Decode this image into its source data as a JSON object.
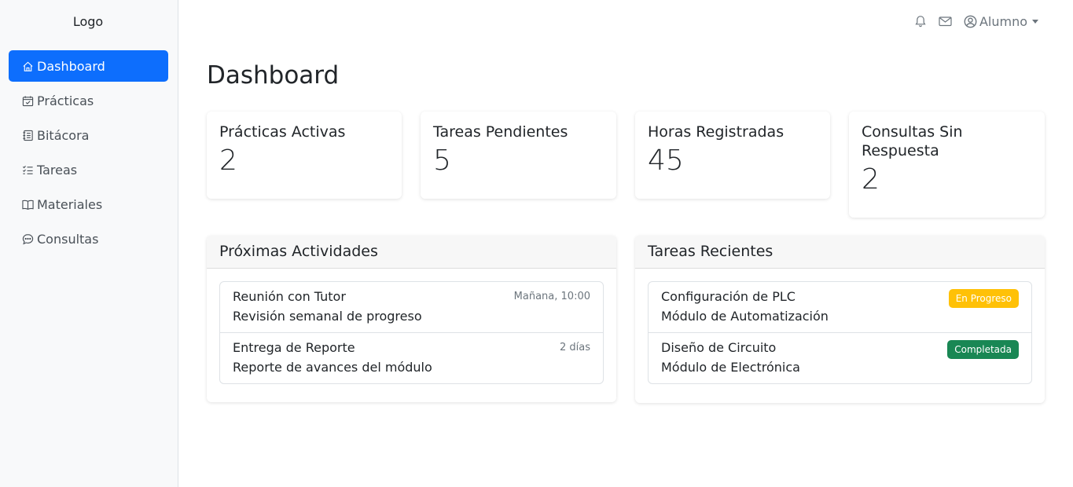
{
  "sidebar": {
    "logo": "Logo",
    "items": [
      {
        "label": "Dashboard",
        "icon": "house-icon",
        "active": true
      },
      {
        "label": "Prácticas",
        "icon": "calendar-check-icon"
      },
      {
        "label": "Bitácora",
        "icon": "journal-icon"
      },
      {
        "label": "Tareas",
        "icon": "list-check-icon"
      },
      {
        "label": "Materiales",
        "icon": "book-icon"
      },
      {
        "label": "Consultas",
        "icon": "chat-dots-icon"
      }
    ]
  },
  "topbar": {
    "notifications_icon": "bell-icon",
    "messages_icon": "envelope-icon",
    "user_icon": "person-circle-icon",
    "user_label": "Alumno"
  },
  "page": {
    "title": "Dashboard"
  },
  "stats": [
    {
      "label": "Prácticas Activas",
      "value": "2"
    },
    {
      "label": "Tareas Pendientes",
      "value": "5"
    },
    {
      "label": "Horas Registradas",
      "value": "45"
    },
    {
      "label": "Consultas Sin Respuesta",
      "value": "2"
    }
  ],
  "upcoming": {
    "title": "Próximas Actividades",
    "items": [
      {
        "title": "Reunión con Tutor",
        "subtitle": "Revisión semanal de progreso",
        "when": "Mañana, 10:00"
      },
      {
        "title": "Entrega de Reporte",
        "subtitle": "Reporte de avances del módulo",
        "when": "2 días"
      }
    ]
  },
  "recent_tasks": {
    "title": "Tareas Recientes",
    "items": [
      {
        "title": "Configuración de PLC",
        "subtitle": "Módulo de Automatización",
        "status": "En Progreso",
        "status_color": "#ffc107"
      },
      {
        "title": "Diseño de Circuito",
        "subtitle": "Módulo de Electrónica",
        "status": "Completada",
        "status_color": "#198754"
      }
    ]
  },
  "colors": {
    "accent": "#0d6efd",
    "sidebar_bg": "#f8f9fa"
  }
}
